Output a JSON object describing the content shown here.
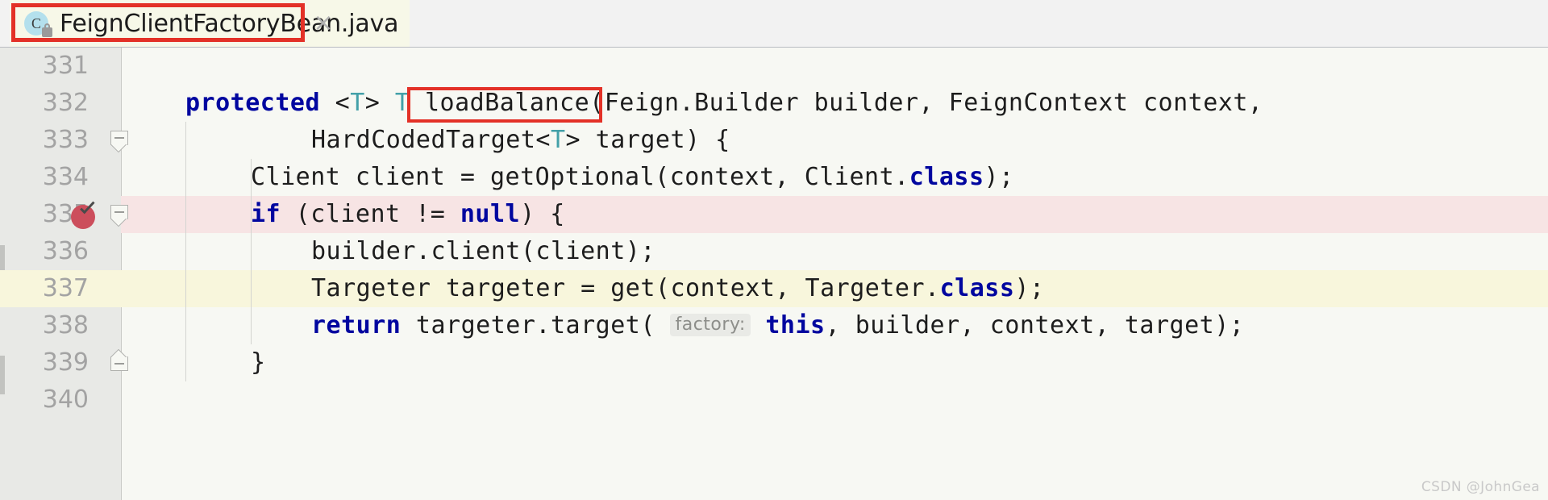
{
  "window": {
    "app": "IntelliJ IDEA Editor"
  },
  "tab": {
    "icon_letter": "C",
    "icon_name": "java-class-icon",
    "lock_badge": "lock-badge",
    "title": "FeignClientFactoryBean.java",
    "close_glyph": "×",
    "highlight_color": "#e33127"
  },
  "editor": {
    "background": "#f7f8f3",
    "gutter_background": "#e8e9e6",
    "keyword_color": "#00069f",
    "type_param_color": "#43a0a8",
    "text_color": "#1d1d1d",
    "pink_highlight": "#f7e4e4",
    "yellow_highlight": "#f8f6dc",
    "breakpoint_color": "#cc4e5c",
    "lines": [
      {
        "number": "331",
        "indent": 0,
        "segments": [],
        "highlight": "none",
        "fold": "none",
        "breakpoint": false
      },
      {
        "number": "332",
        "indent": 0,
        "segments": [
          {
            "text": "    ",
            "style": "plain"
          },
          {
            "text": "protected",
            "style": "kw"
          },
          {
            "text": " ",
            "style": "plain"
          },
          {
            "text": "<",
            "style": "plain"
          },
          {
            "text": "T",
            "style": "tparam"
          },
          {
            "text": "> ",
            "style": "plain"
          },
          {
            "text": "T",
            "style": "tparam"
          },
          {
            "text": " loadBalance(Feign.Builder builder, FeignContext context,",
            "style": "plain"
          }
        ],
        "highlight": "none",
        "fold": "none",
        "breakpoint": false
      },
      {
        "number": "333",
        "indent": 0,
        "segments": [
          {
            "text": "            HardCodedTarget",
            "style": "plain"
          },
          {
            "text": "<",
            "style": "plain"
          },
          {
            "text": "T",
            "style": "tparam"
          },
          {
            "text": "> target) {",
            "style": "plain"
          }
        ],
        "highlight": "none",
        "fold": "down",
        "breakpoint": false
      },
      {
        "number": "334",
        "indent": 0,
        "segments": [
          {
            "text": "        Client client = getOptional(context, Client.",
            "style": "plain"
          },
          {
            "text": "class",
            "style": "kw"
          },
          {
            "text": ");",
            "style": "plain"
          }
        ],
        "highlight": "none",
        "fold": "none",
        "breakpoint": false
      },
      {
        "number": "335",
        "indent": 0,
        "segments": [
          {
            "text": "        ",
            "style": "plain"
          },
          {
            "text": "if",
            "style": "kw"
          },
          {
            "text": " (client != ",
            "style": "plain"
          },
          {
            "text": "null",
            "style": "kw"
          },
          {
            "text": ") {",
            "style": "plain"
          }
        ],
        "highlight": "pink",
        "fold": "down",
        "breakpoint": true
      },
      {
        "number": "336",
        "indent": 0,
        "segments": [
          {
            "text": "            builder.client(client);",
            "style": "plain"
          }
        ],
        "highlight": "none",
        "fold": "none",
        "breakpoint": false
      },
      {
        "number": "337",
        "indent": 0,
        "segments": [
          {
            "text": "            Targeter targeter = get(context, Targeter.",
            "style": "plain"
          },
          {
            "text": "class",
            "style": "kw"
          },
          {
            "text": ");",
            "style": "plain"
          }
        ],
        "highlight": "yellow",
        "fold": "none",
        "breakpoint": false
      },
      {
        "number": "338",
        "indent": 0,
        "segments": [
          {
            "text": "            ",
            "style": "plain"
          },
          {
            "text": "return",
            "style": "kw"
          },
          {
            "text": " targeter.target(",
            "style": "plain"
          },
          {
            "text": "factory:",
            "style": "inlay"
          },
          {
            "text": " ",
            "style": "plain"
          },
          {
            "text": "this",
            "style": "kw"
          },
          {
            "text": ", builder, context, target);",
            "style": "plain"
          }
        ],
        "highlight": "none",
        "fold": "none",
        "breakpoint": false
      },
      {
        "number": "339",
        "indent": 0,
        "segments": [
          {
            "text": "        }",
            "style": "plain"
          }
        ],
        "highlight": "none",
        "fold": "up",
        "breakpoint": false
      },
      {
        "number": "340",
        "indent": 0,
        "segments": [],
        "highlight": "none",
        "fold": "none",
        "breakpoint": false
      }
    ]
  },
  "annotations": {
    "method_name_box_label": "loadBalance",
    "box_color": "#e33127"
  },
  "watermark": {
    "text": "CSDN @JohnGea"
  }
}
